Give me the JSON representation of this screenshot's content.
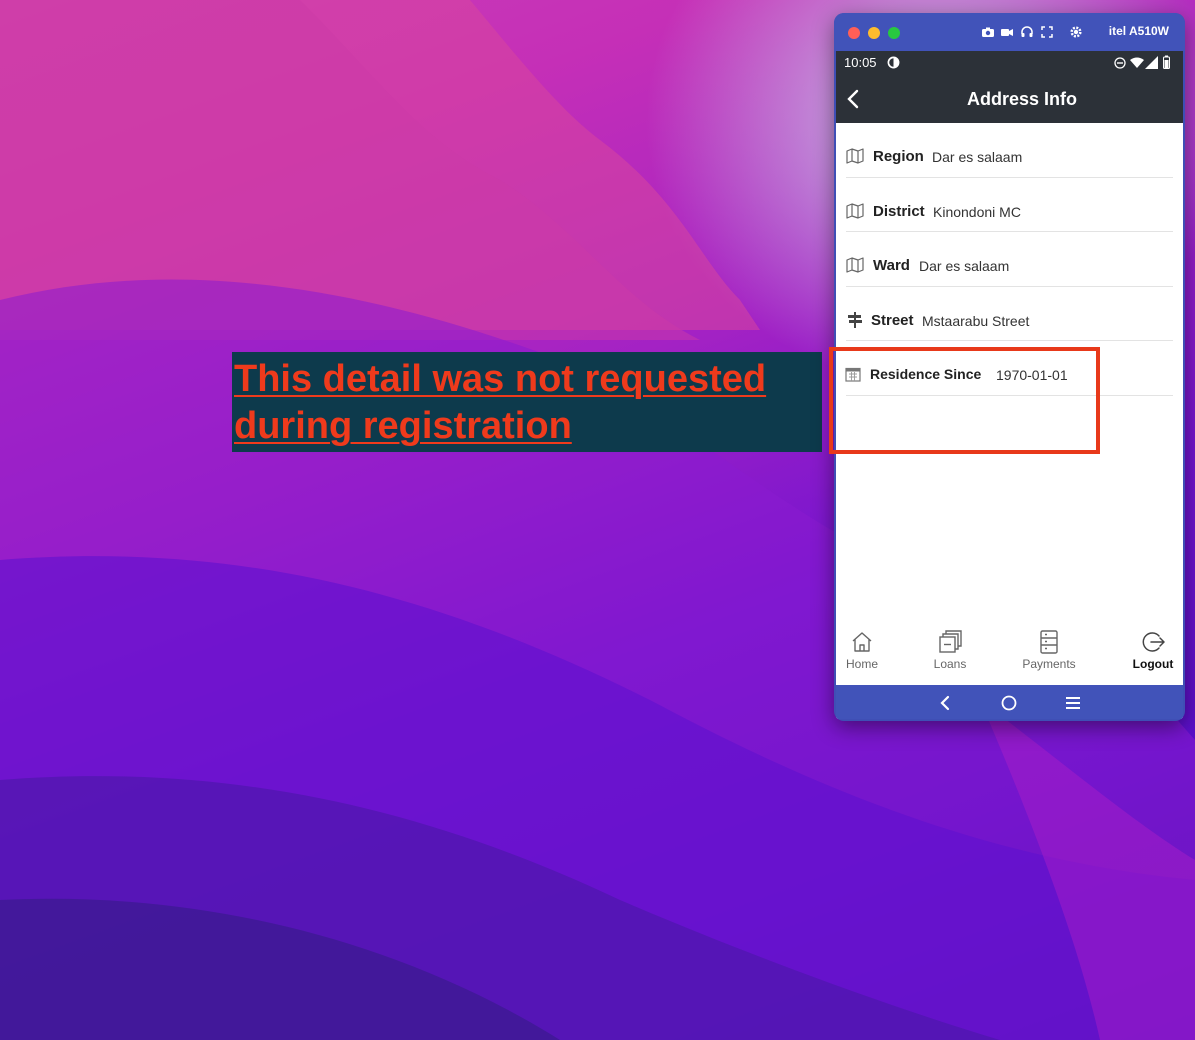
{
  "annotation": {
    "line1": "This detail was not requested",
    "line2": "during registration"
  },
  "emulator": {
    "device_name": "itel A510W",
    "toolbar_icons": [
      "camera-icon",
      "video-icon",
      "headphones-icon",
      "fullscreen-icon",
      "settings-icon"
    ]
  },
  "status_bar": {
    "time": "10:05",
    "icons": [
      "data-saver-icon",
      "do-not-disturb-icon",
      "wifi-icon",
      "signal-icon",
      "battery-icon"
    ]
  },
  "app_bar": {
    "title": "Address Info"
  },
  "address_rows": [
    {
      "icon": "map-icon",
      "label": "Region",
      "value": "Dar es salaam"
    },
    {
      "icon": "map-icon",
      "label": "District",
      "value": "Kinondoni MC"
    },
    {
      "icon": "map-icon",
      "label": "Ward",
      "value": "Dar es salaam"
    },
    {
      "icon": "signpost-icon",
      "label": "Street",
      "value": "Mstaarabu Street"
    },
    {
      "icon": "calendar-icon",
      "label": "Residence Since",
      "value": "1970-01-01"
    }
  ],
  "bottom_nav": [
    {
      "icon": "home-icon",
      "label": "Home"
    },
    {
      "icon": "loans-icon",
      "label": "Loans"
    },
    {
      "icon": "payments-icon",
      "label": "Payments"
    },
    {
      "icon": "logout-icon",
      "label": "Logout"
    }
  ],
  "colors": {
    "highlight": "#e8391a",
    "annotation_text": "#ef3a1c",
    "annotation_bg": "#0d3a4c",
    "emulator_frame": "#4153b9",
    "app_bar": "#2c3138"
  }
}
